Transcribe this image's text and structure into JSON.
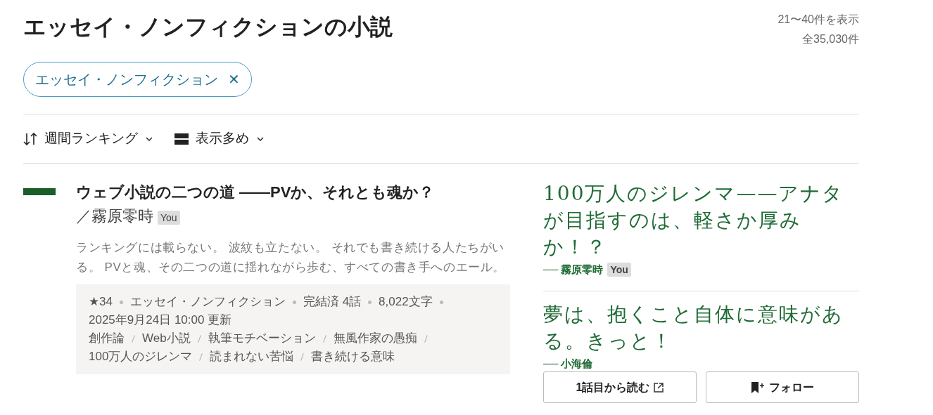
{
  "page_title": "エッセイ・ノンフィクションの小説",
  "result_range": "21〜40件を表示",
  "result_total": "全35,030件",
  "filter_chips": [
    {
      "label": "エッセイ・ノンフィクション",
      "close": "✕"
    }
  ],
  "sort": {
    "label": "週間ランキング"
  },
  "view": {
    "label": "表示多め"
  },
  "works": [
    {
      "title": "ウェブ小説の二つの道 ——PVか、それとも魂か？",
      "author": "／霧原零時",
      "author_badge": "You",
      "description": "ランキングには載らない。 波紋も立たない。 それでも書き続ける人たちがいる。 PVと魂、その二つの道に揺れながら歩む、すべての書き手へのエール。",
      "meta": [
        "★34",
        "エッセイ・ノンフィクション",
        "完結済 4話",
        "8,022文字",
        "2025年9月24日 10:00 更新"
      ],
      "tags": [
        "創作論",
        "Web小説",
        "執筆モチベーション",
        "無風作家の愚痴",
        "100万人のジレンマ",
        "読まれない苦悩",
        "書き続ける意味"
      ],
      "reviews": [
        {
          "text": "100万人のジレンマ——アナタが目指すのは、軽さか厚みか！？",
          "author": "── 霧原零時",
          "author_badge": "You"
        },
        {
          "text": "夢は、抱くこと自体に意味がある。きっと！",
          "author": "── 小海倫"
        }
      ],
      "buttons": [
        {
          "kind": "read",
          "label": "1話目から読む"
        },
        {
          "kind": "follow",
          "label": "フォロー"
        }
      ]
    }
  ]
}
